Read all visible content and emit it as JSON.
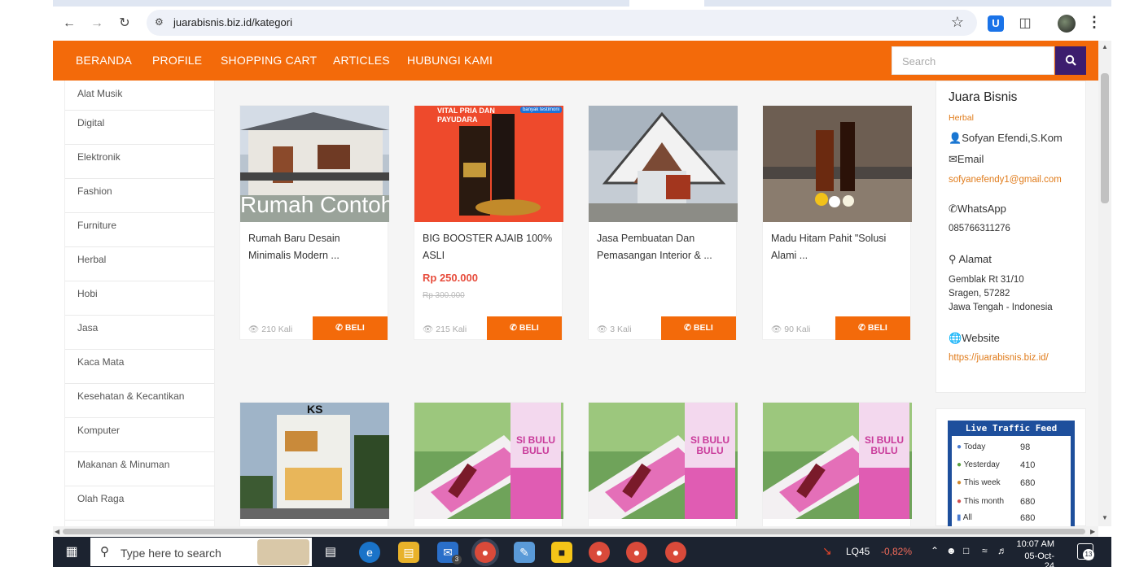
{
  "browser": {
    "url": "juarabisnis.biz.id/kategori"
  },
  "topnav": {
    "items": [
      "BERANDA",
      "PROFILE",
      "SHOPPING CART",
      "ARTICLES",
      "HUBUNGI KAMI"
    ],
    "search_placeholder": "Search"
  },
  "sidebar": {
    "categories": [
      "Alat Musik",
      "Digital",
      "Elektronik",
      "Fashion",
      "Furniture",
      "Herbal",
      "Hobi",
      "Jasa",
      "Kaca Mata",
      "Kesehatan & Kecantikan",
      "Komputer",
      "Makanan & Minuman",
      "Olah Raga"
    ]
  },
  "products": [
    {
      "title": "Rumah Baru Desain Minimalis Modern ...",
      "views": "210 Kali",
      "buy": "BELI",
      "image_caption": "Rumah Contoh"
    },
    {
      "title": "BIG BOOSTER AJAIB 100% ASLI",
      "price": "Rp 250.000",
      "old_price": "Rp 300.000",
      "views": "215 Kali",
      "buy": "BELI",
      "image_text": "VITAL PRIA DAN PAYUDARA",
      "image_badge": "banyak testimoni"
    },
    {
      "title": "Jasa Pembuatan Dan Pemasangan Interior & ...",
      "views": "3 Kali",
      "buy": "BELI"
    },
    {
      "title": "Madu Hitam Pahit \"Solusi Alami ...",
      "views": "90 Kali",
      "buy": "BELI"
    }
  ],
  "row2_products": [
    {
      "image_text": "KS"
    },
    {
      "image_text": "SI BULU BULU"
    },
    {
      "image_text": "SI BULU BULU"
    },
    {
      "image_text": "SI BULU BULU"
    }
  ],
  "profile": {
    "name": "Juara Bisnis",
    "category": "Herbal",
    "owner": "Sofyan Efendi,S.Kom",
    "email_label": "Email",
    "email": "sofyanefendy1@gmail.com",
    "whatsapp_label": "WhatsApp",
    "whatsapp": "085766311276",
    "address_label": "Alamat",
    "address_line1": "Gemblak Rt 31/10",
    "address_line2": "Sragen, 57282",
    "address_line3": "Jawa Tengah - Indonesia",
    "website_label": "Website",
    "website": "https://juarabisnis.biz.id/"
  },
  "traffic": {
    "title": "Live Traffic Feed",
    "rows": [
      {
        "label": "Today",
        "value": "98"
      },
      {
        "label": "Yesterday",
        "value": "410"
      },
      {
        "label": "This week",
        "value": "680"
      },
      {
        "label": "This month",
        "value": "680"
      },
      {
        "label": "All",
        "value": "680"
      }
    ]
  },
  "taskbar": {
    "search_placeholder": "Type here to search",
    "stock": "LQ45",
    "stock_change": "-0,82%",
    "time": "10:07 AM",
    "date": "05-Oct-24",
    "notifications": "13",
    "mail_badge": "3"
  },
  "colors": {
    "brand_orange": "#f36a0a",
    "search_button": "#3c1d6e",
    "price_red": "#e74c3c",
    "link_orange": "#e07b1a"
  }
}
